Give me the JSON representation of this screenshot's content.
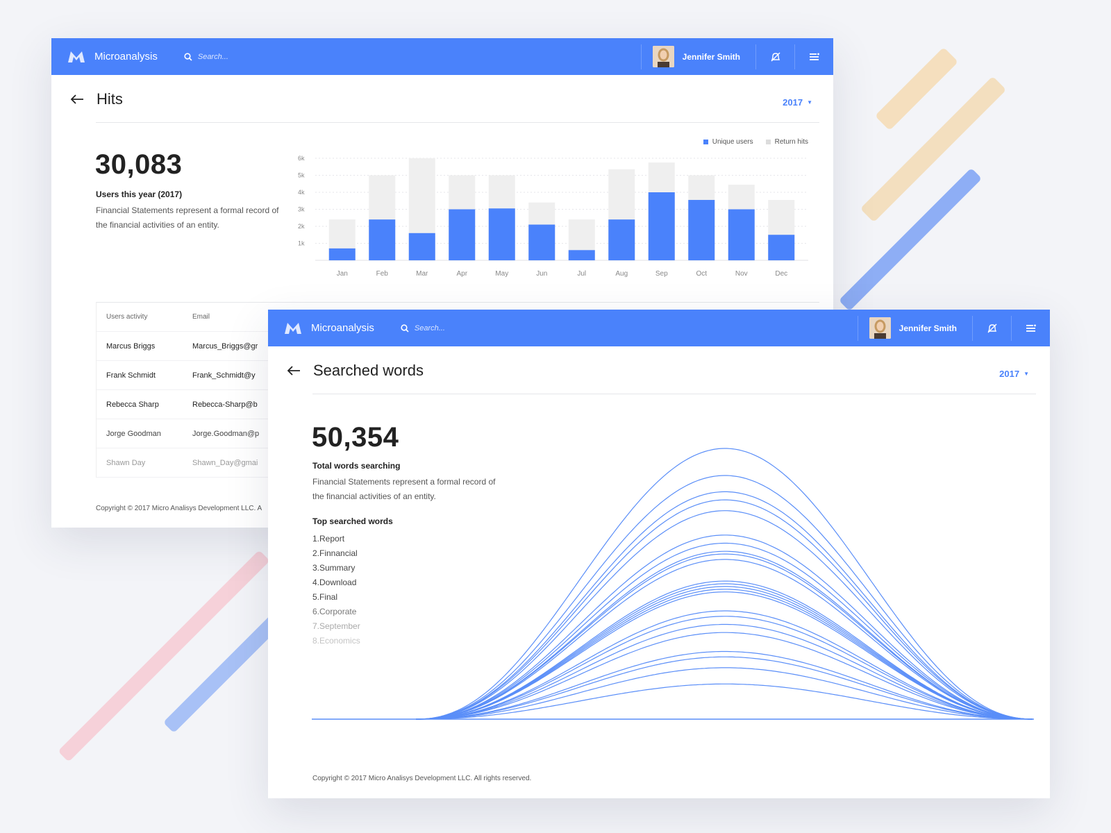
{
  "colors": {
    "accent": "#4a82fb",
    "return_hits": "#efefef",
    "line": "#5a8ef8"
  },
  "window1": {
    "brand": "Microanalysis",
    "search_placeholder": "Search...",
    "user_name": "Jennifer Smith",
    "page_title": "Hits",
    "year": "2017",
    "big_number": "30,083",
    "big_label": "Users this year (2017)",
    "description": "Financial Statements represent a formal record of the financial activities of an entity.",
    "legend": {
      "unique": "Unique users",
      "return": "Return hits"
    },
    "table": {
      "headers": [
        "Users activity",
        "Email"
      ],
      "rows": [
        [
          "Marcus Briggs",
          "Marcus_Briggs@gr"
        ],
        [
          "Frank Schmidt",
          "Frank_Schmidt@y"
        ],
        [
          "Rebecca Sharp",
          "Rebecca-Sharp@b"
        ],
        [
          "Jorge Goodman",
          "Jorge.Goodman@p"
        ],
        [
          "Shawn Day",
          "Shawn_Day@gmai"
        ]
      ]
    },
    "copyright": "Copyright © 2017 Micro Analisys Development LLC. A"
  },
  "window2": {
    "brand": "Microanalysis",
    "search_placeholder": "Search...",
    "user_name": "Jennifer Smith",
    "page_title": "Searched words",
    "year": "2017",
    "big_number": "50,354",
    "big_label": "Total words searching",
    "description": "Financial Statements represent a formal record of the financial activities of an entity.",
    "top_title": "Top searched words",
    "top_words": [
      "1.Report",
      "2.Finnancial",
      "3.Summary",
      "4.Download",
      "5.Final",
      "6.Corporate",
      "7.September",
      "8.Economics"
    ],
    "copyright": "Copyright © 2017 Micro Analisys Development LLC. All rights reserved."
  },
  "chart_data": [
    {
      "type": "bar",
      "title": "",
      "categories": [
        "Jan",
        "Feb",
        "Mar",
        "Apr",
        "May",
        "Jun",
        "Jul",
        "Aug",
        "Sep",
        "Oct",
        "Nov",
        "Dec"
      ],
      "yticks": [
        "1k",
        "2k",
        "3k",
        "4k",
        "5k",
        "6k"
      ],
      "ylim": [
        0,
        6000
      ],
      "series": [
        {
          "name": "Unique users",
          "values": [
            700,
            2400,
            1600,
            3000,
            3050,
            2100,
            600,
            2400,
            4000,
            3550,
            3000,
            1500
          ]
        },
        {
          "name": "Return hits",
          "values": [
            2400,
            5000,
            6000,
            5000,
            5000,
            3400,
            2400,
            5350,
            5750,
            5000,
            4450,
            3550
          ]
        }
      ],
      "legend": "top-right",
      "grid": true
    },
    {
      "type": "line",
      "title": "",
      "curve_peaks": [
        1.0,
        0.9,
        0.84,
        0.81,
        0.77,
        0.68,
        0.65,
        0.62,
        0.61,
        0.59,
        0.51,
        0.5,
        0.49,
        0.48,
        0.47,
        0.4,
        0.38,
        0.35,
        0.32,
        0.25,
        0.23,
        0.19,
        0.13
      ],
      "grid": false
    }
  ]
}
